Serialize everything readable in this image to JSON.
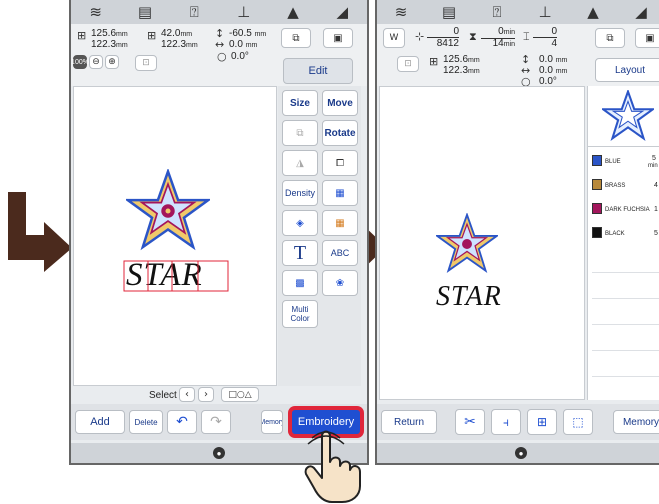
{
  "left_screen": {
    "status_icons": [
      "wifi-icon",
      "document-icon",
      "help-icon",
      "thread-spool-icon",
      "lock-icon",
      "machine-icon"
    ],
    "dimensions": {
      "width": "125.6",
      "height": "122.3",
      "unit": "mm"
    },
    "hoop_size": {
      "width": "42.0",
      "height": "122.3",
      "unit": "mm"
    },
    "offset": {
      "vertical": "-60.5",
      "horizontal": "0.0",
      "rotation": "0.0°",
      "unit": "mm"
    },
    "zoom_label": "100%",
    "edit_button": "Edit",
    "side_buttons": {
      "size": "Size",
      "move": "Move",
      "rotate": "Rotate",
      "density": "Density",
      "multi_color": "Multi\nColor",
      "text": "T",
      "abc": "ABC"
    },
    "design_text": "STAR",
    "select_label": "Select",
    "bottom_buttons": {
      "add": "Add",
      "delete": "Delete",
      "memory": "Memory",
      "embroidery": "Embroidery"
    }
  },
  "right_screen": {
    "status_icons": [
      "wifi-icon",
      "document-icon",
      "help-icon",
      "thread-spool-icon",
      "lock-icon",
      "machine-icon"
    ],
    "stitch_counter": {
      "current": "0",
      "total": "8412"
    },
    "time_counter": {
      "current": "0",
      "unit": "min",
      "total": "14"
    },
    "color_counter": {
      "current": "0",
      "total": "4"
    },
    "dimensions": {
      "width": "125.6",
      "height": "122.3",
      "unit": "mm"
    },
    "offset": {
      "vertical": "0.0",
      "horizontal": "0.0",
      "rotation": "0.0°",
      "unit": "mm"
    },
    "layout_button": "Layout",
    "design_text": "STAR",
    "thread_colors": [
      {
        "name": "BLUE",
        "time": "5",
        "unit": "min",
        "color": "#2b55c7"
      },
      {
        "name": "BRASS",
        "time": "4",
        "color": "#b8893a"
      },
      {
        "name": "DARK FUCHSIA",
        "time": "1",
        "color": "#a3165c"
      },
      {
        "name": "BLACK",
        "time": "5",
        "color": "#111111"
      }
    ],
    "bottom_buttons": {
      "return": "Return",
      "memory": "Memory"
    }
  },
  "colors": {
    "accent_red": "#e0263a",
    "button_blue": "#1f4fd1",
    "arrow_brown": "#4b2a1d",
    "hand_fill": "#f6e3c8"
  }
}
